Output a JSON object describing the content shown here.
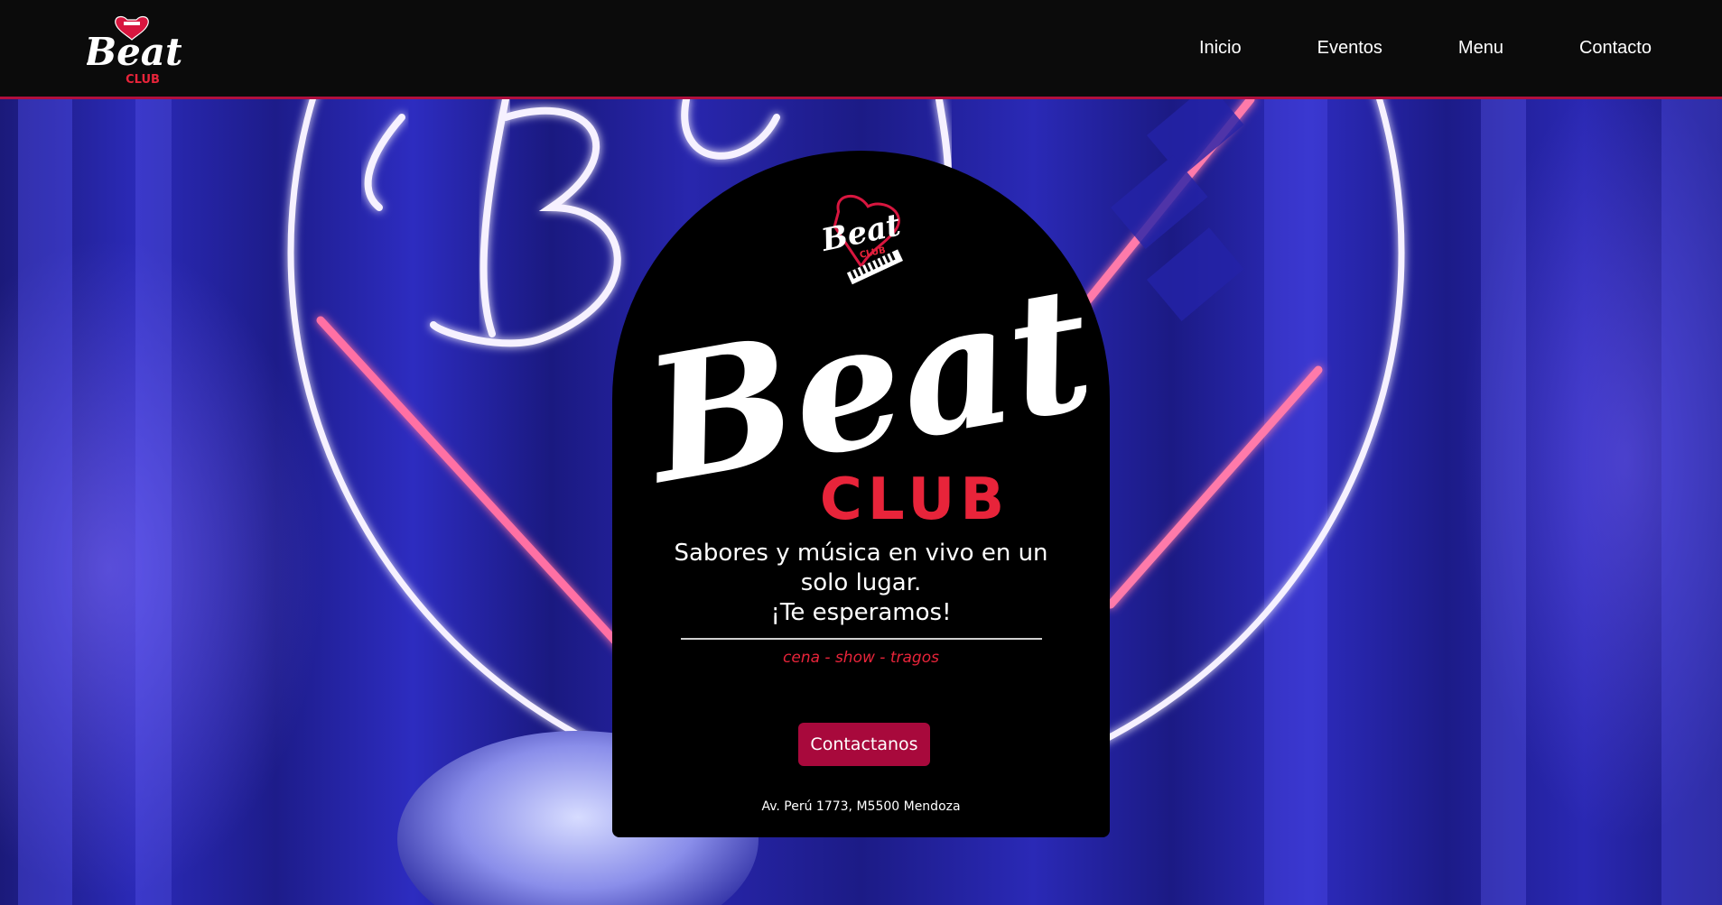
{
  "nav": {
    "logo": {
      "word": "Beat",
      "sub": "CLUB",
      "icon": "piano-heart-logo-icon"
    },
    "links": [
      "Inicio",
      "Eventos",
      "Menu",
      "Contacto"
    ]
  },
  "hero": {
    "background": "neon-beat-club-sign-photo",
    "card": {
      "badge": {
        "word": "Beat",
        "sub": "CLUB",
        "icon": "piano-heart-logo-icon"
      },
      "wordmark": {
        "word": "Beat",
        "sub": "CLUB"
      },
      "tagline": [
        "Sabores y música en vivo en un",
        "solo lugar.",
        "¡Te esperamos!"
      ],
      "subtitle": "cena - show - tragos",
      "cta_label": "Contactanos",
      "address": "Av. Perú 1773, M5500 Mendoza"
    }
  },
  "colors": {
    "nav_bg": "#0b0b0b",
    "accent": "#b0103f",
    "cta_bg": "#a8093c",
    "club_red": "#e8243a",
    "card_bg": "#000000",
    "hero_blue": "#2b2ab8"
  }
}
